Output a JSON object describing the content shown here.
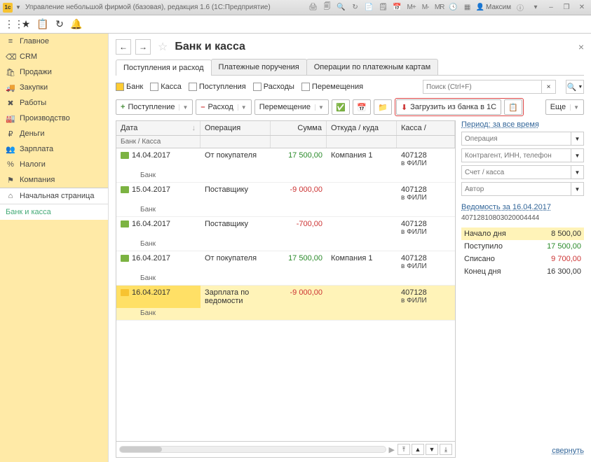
{
  "titlebar": {
    "app_title": "Управление небольшой фирмой (базовая), редакция 1.6  (1С:Предприятие)",
    "user": "Максим"
  },
  "sidebar": {
    "items": [
      {
        "icon": "≡",
        "label": "Главное"
      },
      {
        "icon": "⌫",
        "label": "CRM"
      },
      {
        "icon": "🛍",
        "label": "Продажи"
      },
      {
        "icon": "🚚",
        "label": "Закупки"
      },
      {
        "icon": "✖",
        "label": "Работы"
      },
      {
        "icon": "🏭",
        "label": "Производство"
      },
      {
        "icon": "₽",
        "label": "Деньги"
      },
      {
        "icon": "👥",
        "label": "Зарплата"
      },
      {
        "icon": "%",
        "label": "Налоги"
      },
      {
        "icon": "⚑",
        "label": "Компания"
      }
    ],
    "bottom": [
      {
        "icon": "⌂",
        "label": "Начальная страница"
      },
      {
        "icon": "",
        "label": "Банк и касса"
      }
    ]
  },
  "page": {
    "title": "Банк и касса",
    "tabs": [
      "Поступления и расход",
      "Платежные поручения",
      "Операции по платежным картам"
    ],
    "filters": [
      "Банк",
      "Касса",
      "Поступления",
      "Расходы",
      "Перемещения"
    ],
    "search_ph": "Поиск (Ctrl+F)",
    "buttons": {
      "income": "Поступление",
      "expense": "Расход",
      "move": "Перемещение",
      "load": "Загрузить из банка в 1С",
      "more": "Еще"
    },
    "columns": {
      "date": "Дата",
      "op": "Операция",
      "sum": "Сумма",
      "where": "Откуда / куда",
      "acc": "Касса /"
    },
    "subcol": "Банк / Касса",
    "rows": [
      {
        "date": "14.04.2017",
        "op": "От покупателя",
        "sum": "17 500,00",
        "pos": true,
        "where": "Компания 1",
        "acc1": "407128",
        "acc2": "в ФИЛИ",
        "bank": "Банк"
      },
      {
        "date": "15.04.2017",
        "op": "Поставщику",
        "sum": "-9 000,00",
        "pos": false,
        "where": "",
        "acc1": "407128",
        "acc2": "в ФИЛИ",
        "bank": "Банк"
      },
      {
        "date": "16.04.2017",
        "op": "Поставщику",
        "sum": "-700,00",
        "pos": false,
        "where": "",
        "acc1": "407128",
        "acc2": "в ФИЛИ",
        "bank": "Банк"
      },
      {
        "date": "16.04.2017",
        "op": "От покупателя",
        "sum": "17 500,00",
        "pos": true,
        "where": "Компания 1",
        "acc1": "407128",
        "acc2": "в ФИЛИ",
        "bank": "Банк"
      },
      {
        "date": "16.04.2017",
        "op": "Зарплата по ведомости",
        "sum": "-9 000,00",
        "pos": false,
        "where": "",
        "acc1": "407128",
        "acc2": "в ФИЛИ",
        "bank": "Банк",
        "sel": true
      }
    ]
  },
  "side": {
    "period": "Период: за все время",
    "f1": "Операция",
    "f2": "Контрагент, ИНН, телефон",
    "f3": "Счет / касса",
    "f4": "Автор",
    "vh": "Ведомость за 16.04.2017",
    "accnum": "40712810803020004444",
    "summary": [
      {
        "label": "Начало дня",
        "val": "8 500,00",
        "cls": ""
      },
      {
        "label": "Поступило",
        "val": "17 500,00",
        "cls": "pos"
      },
      {
        "label": "Списано",
        "val": "9 700,00",
        "cls": "neg"
      },
      {
        "label": "Конец дня",
        "val": "16 300,00",
        "cls": ""
      }
    ],
    "collapse": "свернуть"
  }
}
